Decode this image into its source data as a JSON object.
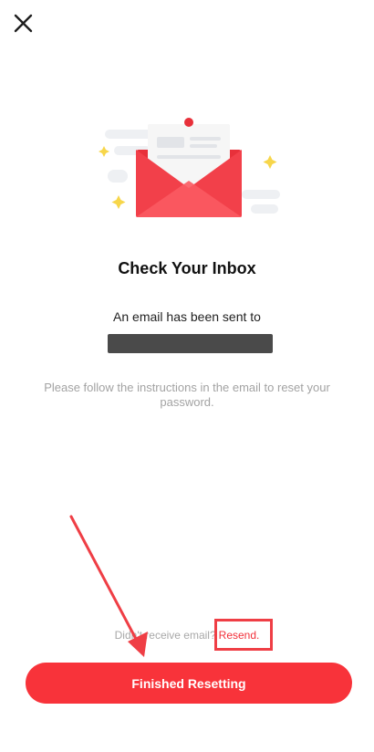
{
  "header": {
    "close_icon": "close-icon"
  },
  "illustration": {
    "icon": "email-envelope-illustration",
    "accent_color": "#f8333a"
  },
  "content": {
    "title": "Check Your Inbox",
    "sent_text": "An email has been sent to",
    "instructions": "Please follow the instructions in the email to reset your password."
  },
  "footer": {
    "resend_prompt": "Didn't receive email?",
    "resend_link": "Resend.",
    "primary_button": "Finished Resetting"
  },
  "colors": {
    "primary": "#f8333a",
    "annotation": "#ef3e45"
  }
}
